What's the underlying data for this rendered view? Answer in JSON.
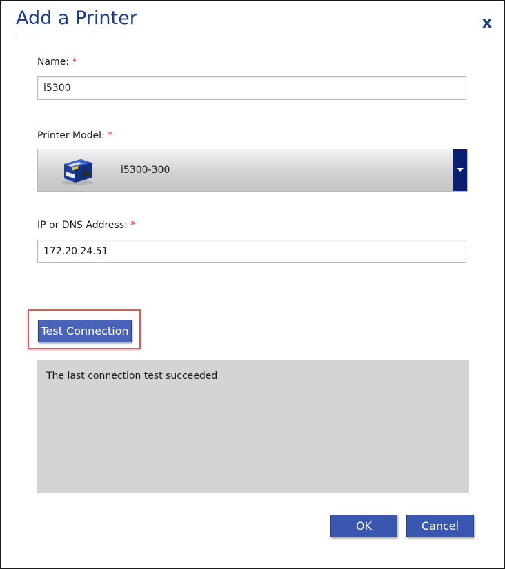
{
  "dialog": {
    "title": "Add a Printer",
    "close_label": "x"
  },
  "name_field": {
    "label": "Name:",
    "required_mark": "*",
    "value": "i5300"
  },
  "model_field": {
    "label": "Printer Model:",
    "required_mark": "*",
    "selected_value": "i5300-300",
    "image_icon": "printer-icon",
    "arrow_icon": "chevron-down-icon",
    "arrow_color": "#0c1f6e"
  },
  "address_field": {
    "label": "IP or DNS Address:",
    "required_mark": "*",
    "value": "172.20.24.51"
  },
  "test_button": {
    "label": "Test Connection",
    "highlight_color": "#e05a5a"
  },
  "result": {
    "text": "The last connection test succeeded"
  },
  "footer": {
    "ok_label": "OK",
    "cancel_label": "Cancel"
  },
  "colors": {
    "title": "#1f3c88",
    "button": "#3a57b0",
    "required": "#d02020",
    "panel": "#d4d4d4"
  }
}
